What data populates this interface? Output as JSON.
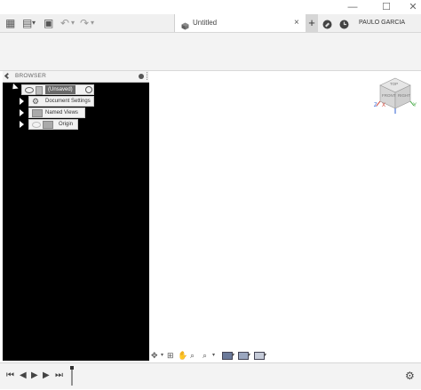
{
  "window": {
    "min_glyph": "—",
    "max_glyph": "☐",
    "close_glyph": "✕"
  },
  "toolbar": {
    "grid_glyph": "▦",
    "file_glyph": "▤",
    "dropdown_glyph": "▾",
    "save_glyph": "▣",
    "undo_glyph": "↶",
    "redo_glyph": "↷"
  },
  "document_tab": {
    "title": "Untitled",
    "close_glyph": "×"
  },
  "header": {
    "new_tab_glyph": "+",
    "user_name": "PAULO GARCIA"
  },
  "browser": {
    "header_label": "BROWSER",
    "root_label": "(Unsaved)",
    "items": [
      {
        "label": "Document Settings"
      },
      {
        "label": "Named Views"
      },
      {
        "label": "Origin"
      }
    ]
  },
  "viewcube": {
    "face_top": "TOP",
    "face_front": "FRONT",
    "face_right": "RIGHT",
    "axis_x": "X",
    "axis_y": "Y",
    "axis_z": "Z"
  },
  "nav_toolbar": {
    "dropdown_glyph": "▾"
  },
  "timeline": {
    "first_glyph": "⏮",
    "prev_glyph": "◀",
    "play_glyph": "▶",
    "next_glyph": "▶",
    "last_glyph": "⏭",
    "settings_glyph": "⚙"
  },
  "colors": {
    "browser_bg": "#000000",
    "chrome_bg": "#f3f3f3",
    "axis_x": "#d0392b",
    "axis_y": "#3fa63f",
    "axis_z": "#2f5fd0"
  }
}
